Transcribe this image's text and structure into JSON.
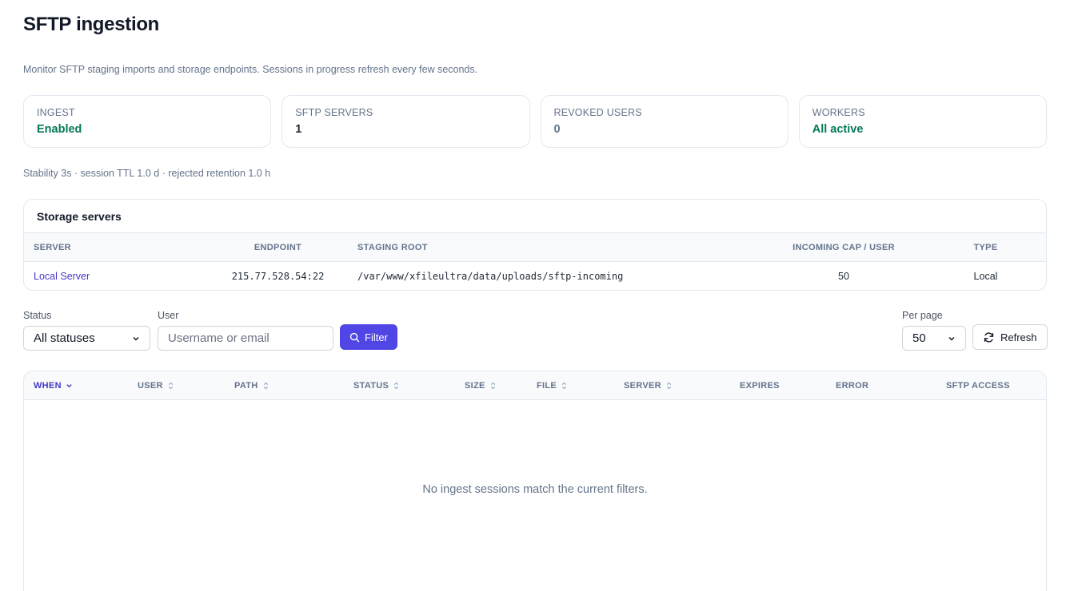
{
  "page": {
    "title": "SFTP ingestion",
    "subtitle": "Monitor SFTP staging imports and storage endpoints. Sessions in progress refresh every few seconds."
  },
  "cards": [
    {
      "label": "INGEST",
      "value": "Enabled",
      "color": "#047857"
    },
    {
      "label": "SFTP SERVERS",
      "value": "1"
    },
    {
      "label": "REVOKED USERS",
      "value": "0"
    },
    {
      "label": "WORKERS",
      "value": "All active",
      "color": "#047857"
    }
  ],
  "meta": "Stability 3s · session TTL 1.0 d · rejected retention 1.0 h",
  "servers": {
    "title": "Storage servers",
    "headers": [
      "SERVER",
      "ENDPOINT",
      "STAGING ROOT",
      "INCOMING CAP / USER",
      "TYPE"
    ],
    "rows": [
      {
        "server": "Local Server",
        "endpoint": "215.77.528.54:22",
        "staging_root": "/var/www/xfileultra/data/uploads/sftp-incoming",
        "cap": "50",
        "type": "Local"
      }
    ]
  },
  "filters": {
    "status_label": "Status",
    "status_value": "All statuses",
    "user_label": "User",
    "user_placeholder": "Username or email",
    "user_value": "",
    "filter_button": "Filter",
    "per_page_label": "Per page",
    "per_page_value": "50",
    "refresh_button": "Refresh"
  },
  "sessions": {
    "columns": [
      {
        "label": "WHEN",
        "sort": "desc-active"
      },
      {
        "label": "USER",
        "sort": "sortable"
      },
      {
        "label": "PATH",
        "sort": "sortable"
      },
      {
        "label": "STATUS",
        "sort": "sortable"
      },
      {
        "label": "SIZE",
        "sort": "sortable"
      },
      {
        "label": "FILE",
        "sort": "sortable"
      },
      {
        "label": "SERVER",
        "sort": "sortable"
      },
      {
        "label": "EXPIRES",
        "sort": "none"
      },
      {
        "label": "ERROR",
        "sort": "none"
      },
      {
        "label": "SFTP ACCESS",
        "sort": "none"
      }
    ],
    "empty_message": "No ingest sessions match the current filters."
  },
  "colors": {
    "accent": "#4f46e5",
    "link": "#4338ca",
    "success": "#047857",
    "muted": "#64748b",
    "border": "#e2e8f0"
  }
}
